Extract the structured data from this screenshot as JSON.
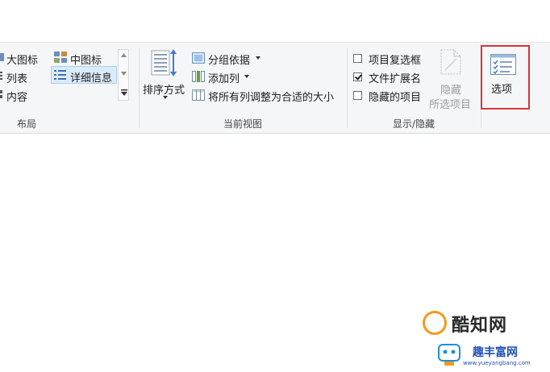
{
  "layout_group": {
    "label": "布局",
    "items": {
      "large_icons": "大图标",
      "medium_icons": "中图标",
      "list": "列表",
      "details": "详细信息",
      "content": "内容"
    }
  },
  "current_view": {
    "label": "当前视图",
    "sort_by": "排序方式",
    "group_by": "分组依据",
    "add_columns": "添加列",
    "size_all_columns": "将所有列调整为合适的大小"
  },
  "show_hide": {
    "label": "显示/隐藏",
    "item_checkboxes": {
      "label": "项目复选框",
      "checked": false
    },
    "file_name_extensions": {
      "label": "文件扩展名",
      "checked": true
    },
    "hidden_items": {
      "label": "隐藏的项目",
      "checked": false
    },
    "hide_selected_line1": "隐藏",
    "hide_selected_line2": "所选项目"
  },
  "options": {
    "label": "选项"
  },
  "watermark": {
    "brand1": "酷知网",
    "brand2": "趣丰富网",
    "url": "www.yueyangbang.com"
  },
  "colors": {
    "highlight_red": "#d9343a",
    "selection_blue": "#dcebfb",
    "watermark_orange": "#f39a1e",
    "watermark_blue": "#1f4fb6"
  }
}
